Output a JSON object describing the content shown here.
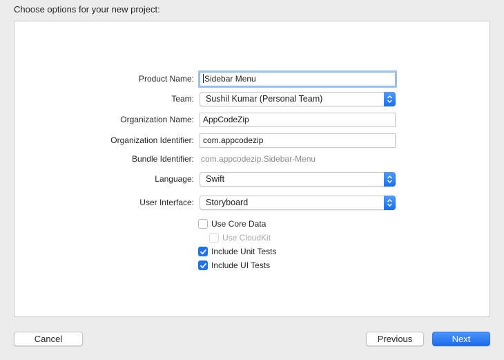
{
  "header": {
    "title": "Choose options for your new project:"
  },
  "form": {
    "product_name": {
      "label": "Product Name:",
      "value": "Sidebar Menu"
    },
    "team": {
      "label": "Team:",
      "value": "Sushil Kumar (Personal Team)"
    },
    "organization_name": {
      "label": "Organization Name:",
      "value": "AppCodeZip"
    },
    "organization_identifier": {
      "label": "Organization Identifier:",
      "value": "com.appcodezip"
    },
    "bundle_identifier": {
      "label": "Bundle Identifier:",
      "value": "com.appcodezip.Sidebar-Menu"
    },
    "language": {
      "label": "Language:",
      "value": "Swift"
    },
    "user_interface": {
      "label": "User Interface:",
      "value": "Storyboard"
    },
    "options": {
      "use_core_data": {
        "label": "Use Core Data",
        "checked": false,
        "enabled": true
      },
      "use_cloudkit": {
        "label": "Use CloudKit",
        "checked": false,
        "enabled": false
      },
      "include_unit_tests": {
        "label": "Include Unit Tests",
        "checked": true,
        "enabled": true
      },
      "include_ui_tests": {
        "label": "Include UI Tests",
        "checked": true,
        "enabled": true
      }
    }
  },
  "footer": {
    "cancel_label": "Cancel",
    "previous_label": "Previous",
    "next_label": "Next"
  },
  "colors": {
    "accent": "#1f71ee",
    "focus_ring": "#9dc3f3",
    "window_bg": "#ececec"
  }
}
